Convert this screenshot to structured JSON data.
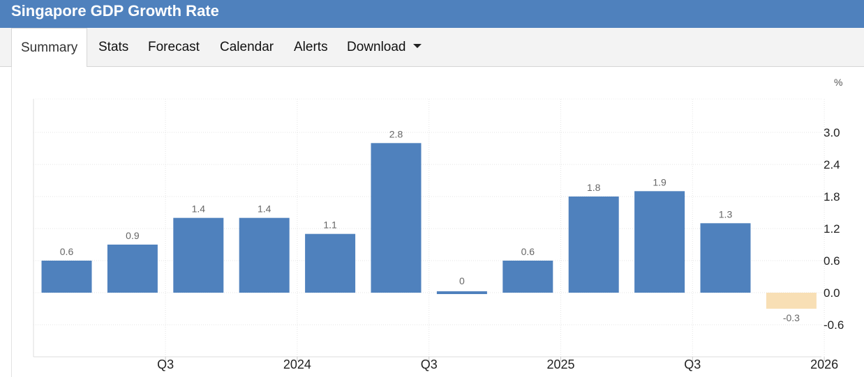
{
  "header": {
    "title": "Singapore GDP Growth Rate"
  },
  "tabs": [
    {
      "label": "Summary",
      "active": true
    },
    {
      "label": "Stats"
    },
    {
      "label": "Forecast"
    },
    {
      "label": "Calendar"
    },
    {
      "label": "Alerts"
    },
    {
      "label": "Download",
      "has_dropdown": true
    }
  ],
  "chart_data": {
    "type": "bar",
    "unit_label": "%",
    "values": [
      0.6,
      0.9,
      1.4,
      1.4,
      1.1,
      2.8,
      0,
      0.6,
      1.8,
      1.9,
      1.3,
      -0.3
    ],
    "data_labels": [
      "0.6",
      "0.9",
      "1.4",
      "1.4",
      "1.1",
      "2.8",
      "0",
      "0.6",
      "1.8",
      "1.9",
      "1.3",
      "-0.3"
    ],
    "x_tick_labels": [
      "Q3",
      "2024",
      "Q3",
      "2025",
      "Q3",
      "2026"
    ],
    "y_ticks": [
      3.0,
      2.4,
      1.8,
      1.2,
      0.6,
      0.0,
      -0.6
    ],
    "y_tick_labels": [
      "3.0",
      "2.4",
      "1.8",
      "1.2",
      "0.6",
      "0.0",
      "-0.6"
    ],
    "ylim": [
      -1.2,
      3.6
    ],
    "y_axis_position": "right",
    "grid": true,
    "colors": {
      "positive": "#4f81bd",
      "negative": "#f8dfb5"
    }
  }
}
